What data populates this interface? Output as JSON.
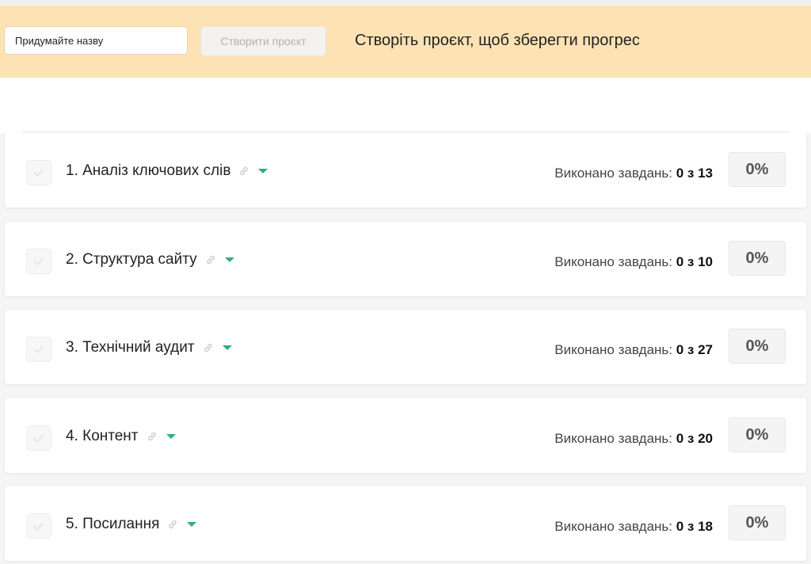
{
  "banner": {
    "project_name_placeholder": "Придумайте назву",
    "create_button_label": "Створити проєкт",
    "message": "Створіть проєкт, щоб зберегти прогрес"
  },
  "colors": {
    "banner_bg": "#fde2b4",
    "accent_green": "#2fb07a"
  },
  "sections": [
    {
      "title": "1. Аналіз ключових слів",
      "stats_label": "Виконано завдань:",
      "stats_value": "0 з 13",
      "percent": "0%"
    },
    {
      "title": "2. Структура сайту",
      "stats_label": "Виконано завдань:",
      "stats_value": "0 з 10",
      "percent": "0%"
    },
    {
      "title": "3. Технічний аудит",
      "stats_label": "Виконано завдань:",
      "stats_value": "0 з 27",
      "percent": "0%"
    },
    {
      "title": "4. Контент",
      "stats_label": "Виконано завдань:",
      "stats_value": "0 з 20",
      "percent": "0%"
    },
    {
      "title": "5. Посилання",
      "stats_label": "Виконано завдань:",
      "stats_value": "0 з 18",
      "percent": "0%"
    }
  ]
}
